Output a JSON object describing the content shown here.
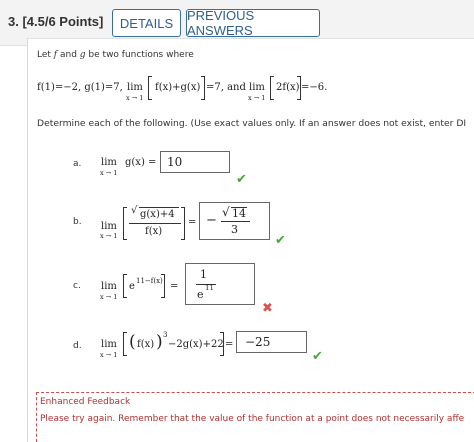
{
  "header": {
    "question_number": "3. [4.5/6 Points]",
    "details_label": "DETAILS",
    "previous_answers_label": "PREVIOUS ANSWERS"
  },
  "intro": {
    "line1_a": "Let ",
    "f": "f",
    "and": " and ",
    "g": "g",
    "line1_b": " be two functions where",
    "conditions_a": "f(1)=−2, g(1)=7,",
    "lim": "lim",
    "sub_x1": "x → 1",
    "cond_expr1": "f(x)+g(x)",
    "eq7_and": "=7, and",
    "cond_expr2": "2f(x)",
    "eq_neg6": "=−6.",
    "instruction": "Determine each of the following. (Use exact values only. If an answer does not exist, enter DI"
  },
  "parts": {
    "a": {
      "label": "a.",
      "expr": "g(x) =",
      "answer": "10"
    },
    "b": {
      "label": "b.",
      "num": "g(x)+4",
      "den": "f(x)",
      "eq": "=",
      "ans_minus": "−",
      "ans_num": "14",
      "ans_den": "3"
    },
    "c": {
      "label": "c.",
      "base": "e",
      "exponent": "11−f(x)",
      "eq": "=",
      "ans_num": "1",
      "ans_den_base": "e",
      "ans_den_exp": "11"
    },
    "d": {
      "label": "d.",
      "expr_a": "f(x)",
      "expr_exp": "3",
      "expr_b": "−2g(x)+22",
      "eq": "=",
      "answer": "−25"
    }
  },
  "feedback": {
    "title": "Enhanced Feedback",
    "text": "Please try again. Remember that the value of the function at a point does not necessarily affe"
  },
  "status": {
    "a": "correct",
    "b": "correct",
    "c": "incorrect",
    "d": "correct"
  },
  "colors": {
    "correct": "#49a53c",
    "incorrect": "#d9534f",
    "feedback": "#b03030",
    "button": "#2f5f8e"
  }
}
